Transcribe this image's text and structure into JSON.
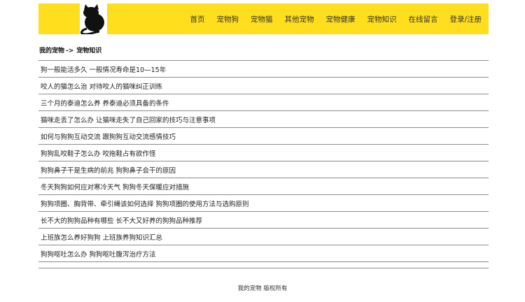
{
  "header": {
    "logo_icon": "black-cat-icon",
    "brand_color": "#ffdf1d",
    "nav": [
      {
        "label": "首页"
      },
      {
        "label": "宠物狗"
      },
      {
        "label": "宠物猫"
      },
      {
        "label": "其他宠物"
      },
      {
        "label": "宠物健康"
      },
      {
        "label": "宠物知识"
      },
      {
        "label": "在线留言"
      },
      {
        "label": "登录/注册"
      }
    ]
  },
  "breadcrumb": {
    "home": "我的宠物",
    "separator": "->",
    "current": "宠物知识"
  },
  "articles": [
    {
      "title": "狗一般能活多久 一般情况寿命是10—15年"
    },
    {
      "title": "咬人的猫怎么治 对待咬人的猫咪纠正训练"
    },
    {
      "title": "三个月的泰迪怎么养 养泰迪必须具备的条件"
    },
    {
      "title": "猫咪走丢了怎么办 让猫咪走失了自己回家的技巧与注意事项"
    },
    {
      "title": "如何与狗狗互动交流 跟狗狗互动交流感情技巧"
    },
    {
      "title": "狗狗乱咬鞋子怎么办 咬拖鞋占有欲作怪"
    },
    {
      "title": "狗狗鼻子干是生病的前兆 狗狗鼻子会干的原因"
    },
    {
      "title": "冬天狗狗如何应对寒冷天气 狗狗冬天保暖应对措施"
    },
    {
      "title": "狗狗项圈、胸背带、牵引绳该如何选择 狗狗项圈的使用方法与选购原则"
    },
    {
      "title": "长不大的狗狗品种有哪些 长不大又好养的狗狗品种推荐"
    },
    {
      "title": "上班族怎么养好狗狗 上班族养狗知识汇总"
    },
    {
      "title": "狗狗呕吐怎么办 狗狗呕吐腹泻治疗方法"
    }
  ],
  "footer": {
    "text": "我的宠物 版权所有"
  }
}
